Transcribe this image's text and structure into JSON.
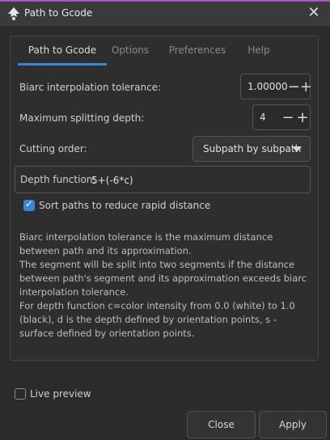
{
  "window": {
    "title": "Path to Gcode",
    "close_icon": "close-icon"
  },
  "tabs": [
    "Path to Gcode",
    "Options",
    "Preferences",
    "Help"
  ],
  "fields": {
    "biarc": {
      "label": "Biarc interpolation tolerance:",
      "value": "1.00000"
    },
    "splitting": {
      "label": "Maximum splitting depth:",
      "value": "4"
    },
    "cutting": {
      "label": "Cutting order:",
      "selected": "Subpath by subpath"
    },
    "depth": {
      "label": "Depth function:",
      "value": "5+(-6*c)"
    }
  },
  "sort_paths": {
    "label": "Sort paths to reduce rapid distance",
    "checked": true
  },
  "description": [
    "Biarc interpolation tolerance is the maximum distance between path and its approximation.",
    "The segment will be split into two segments if the distance between path's segment and its approximation exceeds biarc interpolation tolerance.",
    "For depth function c=color intensity from 0.0 (white) to 1.0 (black), d is the depth defined by orientation points, s - surface defined by orientation points."
  ],
  "live_preview": {
    "label": "Live preview",
    "checked": false
  },
  "buttons": {
    "close": "Close",
    "apply": "Apply"
  },
  "colors": {
    "accent": "#3a86d4",
    "title_border": "#a855c7",
    "background": "#2b2b2b"
  }
}
